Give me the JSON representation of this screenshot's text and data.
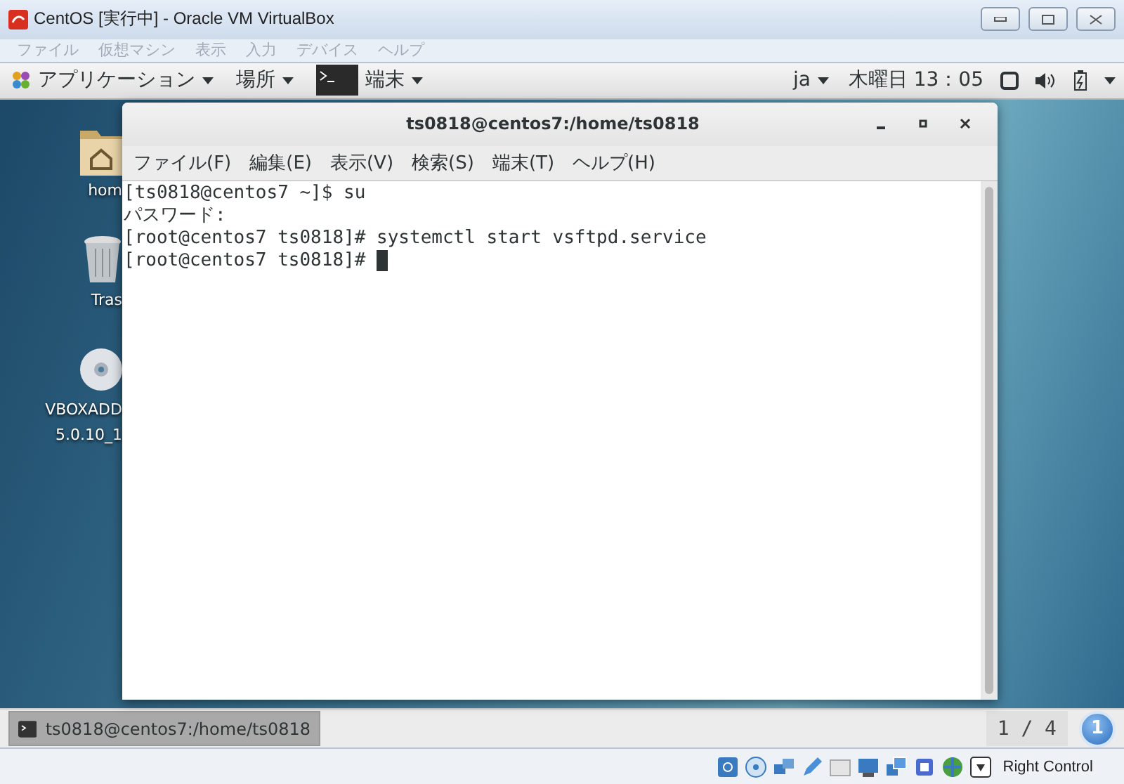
{
  "host_window": {
    "title": "CentOS [実行中] - Oracle VM VirtualBox",
    "menu": [
      {
        "label": "ファイル",
        "disabled": true
      },
      {
        "label": "仮想マシン",
        "disabled": true
      },
      {
        "label": "表示",
        "disabled": true
      },
      {
        "label": "入力",
        "disabled": true
      },
      {
        "label": "デバイス",
        "disabled": true
      },
      {
        "label": "ヘルプ",
        "disabled": true
      }
    ]
  },
  "top_bar": {
    "menus": [
      {
        "kind": "apps",
        "label": "アプリケーション"
      },
      {
        "kind": "places",
        "label": "場所"
      },
      {
        "kind": "app",
        "label": "端末"
      }
    ],
    "input_method": "ja",
    "clock": "木曜日 13：05"
  },
  "desktop_icons": [
    {
      "kind": "folder",
      "lines": [
        "hom"
      ]
    },
    {
      "kind": "trash",
      "lines": [
        "Tras"
      ]
    },
    {
      "kind": "disc",
      "lines": [
        "VBOXADD",
        "5.0.10_1"
      ]
    }
  ],
  "terminal": {
    "title": "ts0818@centos7:/home/ts0818",
    "menu": [
      "ファイル(F)",
      "編集(E)",
      "表示(V)",
      "検索(S)",
      "端末(T)",
      "ヘルプ(H)"
    ],
    "lines": [
      "[ts0818@centos7 ~]$ su",
      "パスワード:",
      "[root@centos7 ts0818]# systemctl start vsftpd.service",
      "[root@centos7 ts0818]# "
    ],
    "cursor_visible": true
  },
  "taskbar": {
    "tasks": [
      {
        "label": "ts0818@centos7:/home/ts0818",
        "selected": true
      }
    ],
    "workspace": "1 / 4",
    "notification_count": "1"
  },
  "status_bar": {
    "host_key": "Right Control"
  }
}
